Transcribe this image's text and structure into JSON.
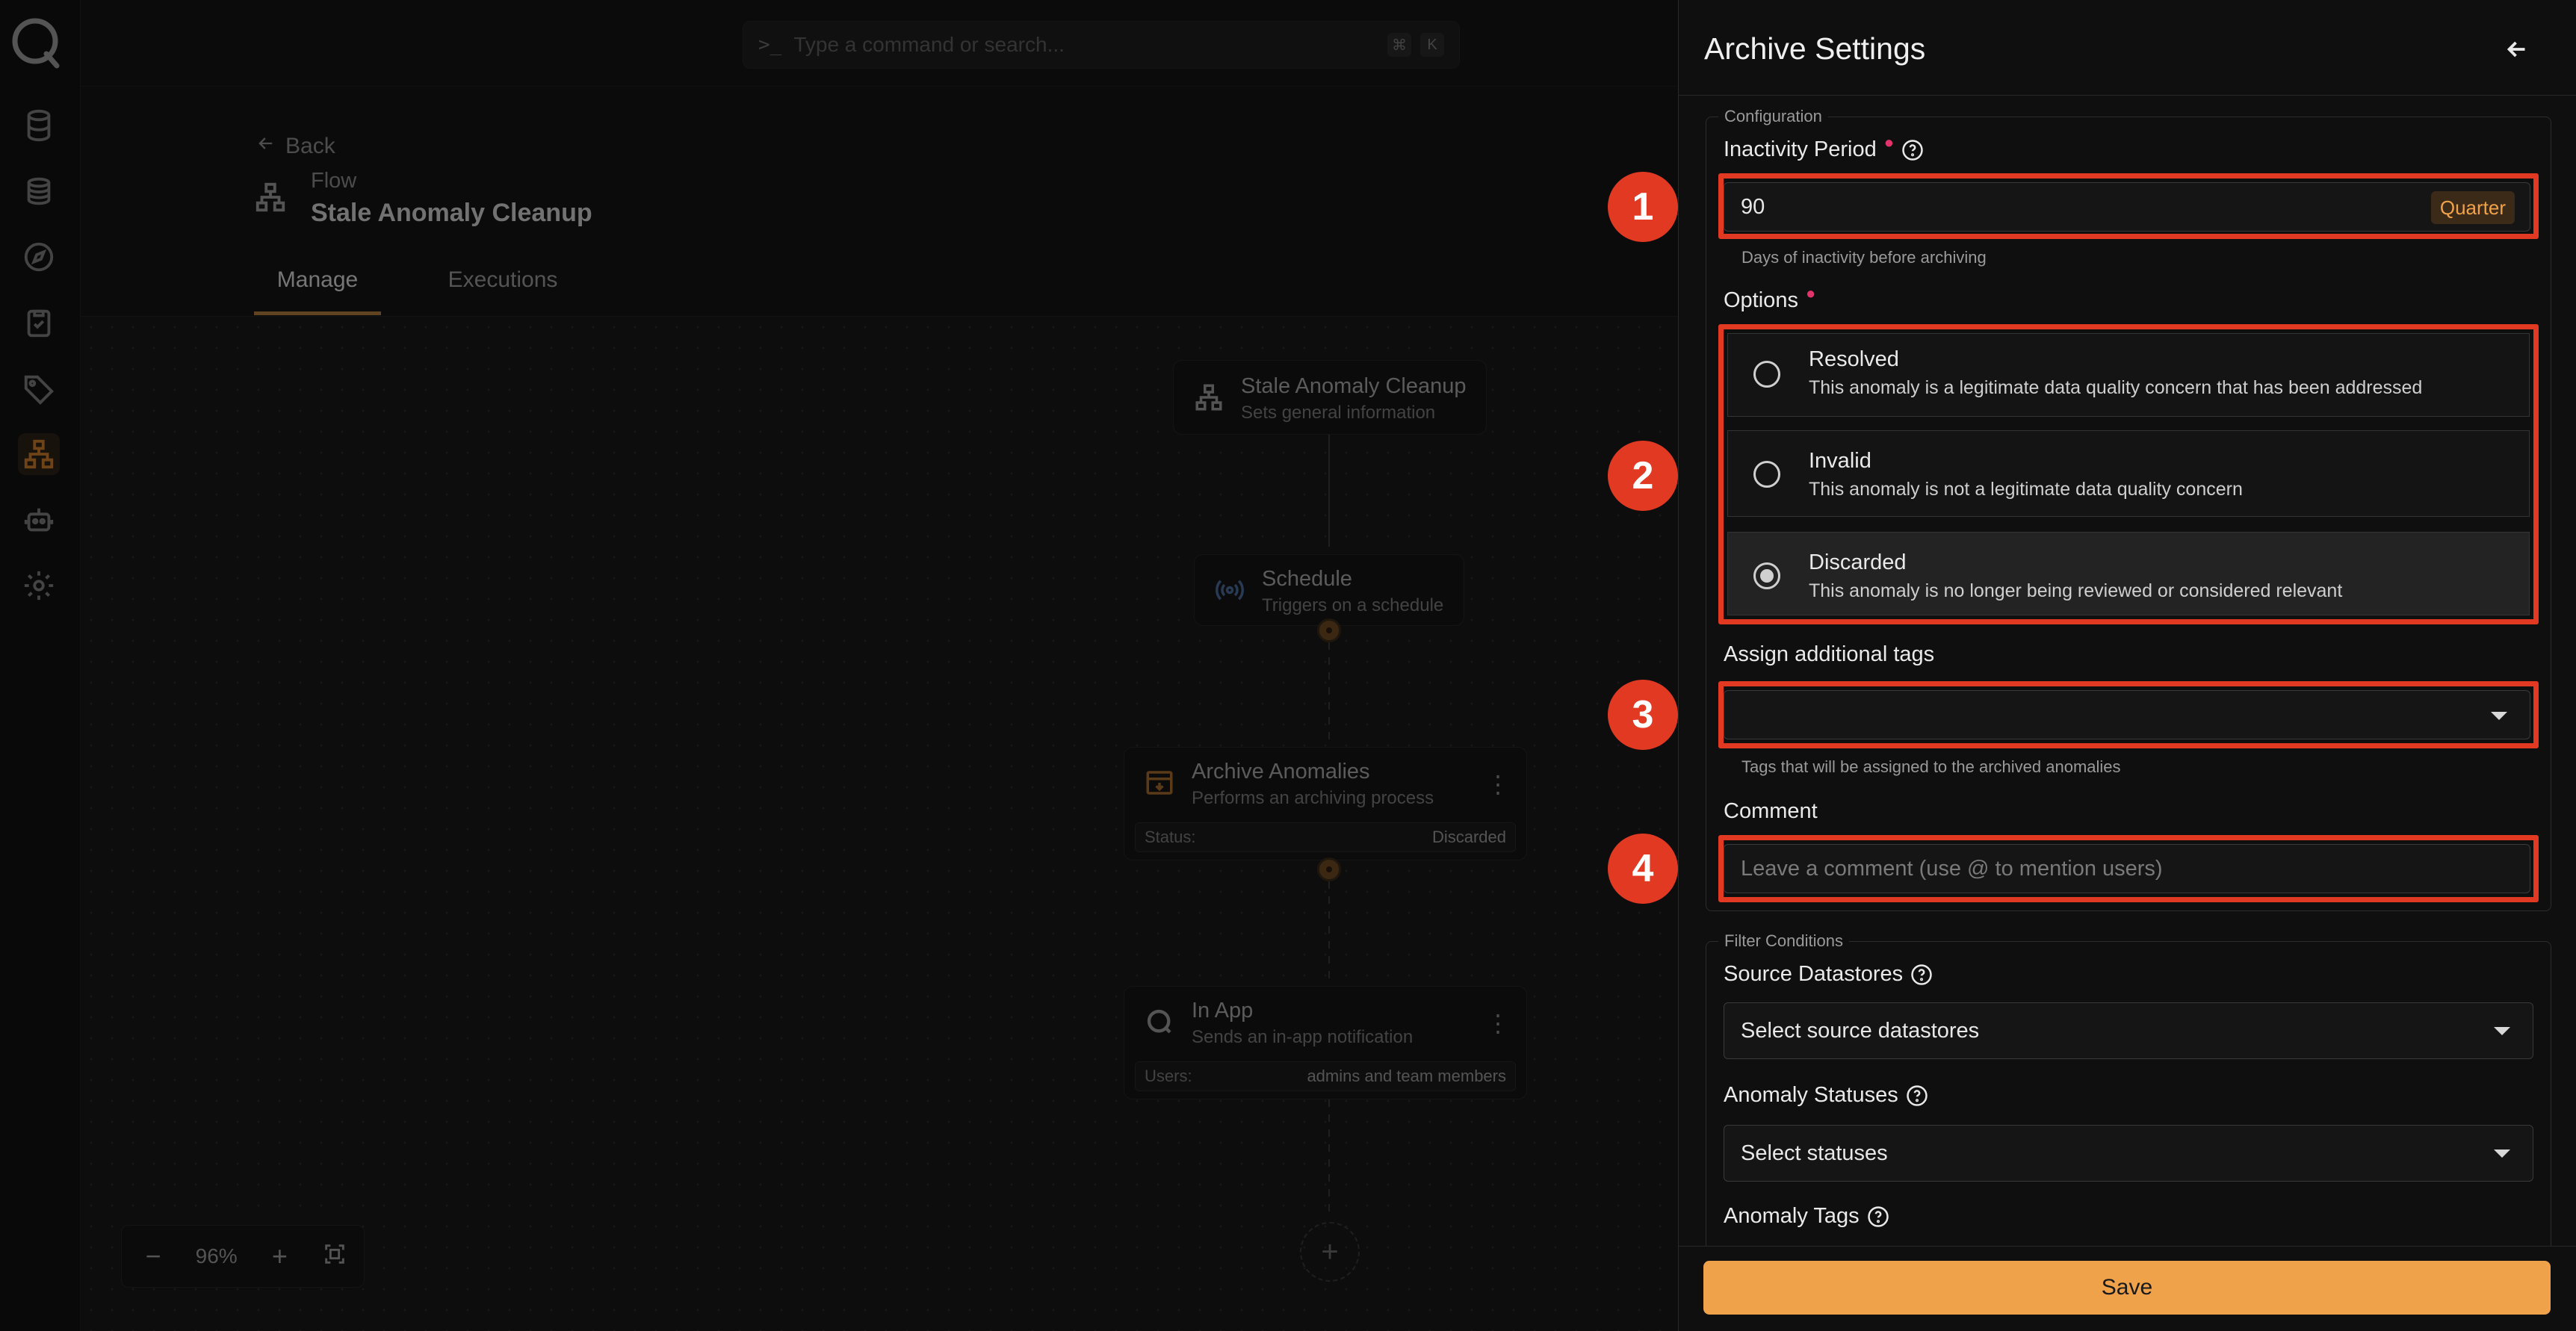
{
  "command_bar": {
    "placeholder": "Type a command or search...",
    "shortcut_1": "⌘",
    "shortcut_2": "K"
  },
  "header": {
    "back_label": "Back",
    "kicker": "Flow",
    "title": "Stale Anomaly Cleanup",
    "tabs": [
      "Manage",
      "Executions"
    ]
  },
  "flow_nodes": [
    {
      "title": "Stale Anomaly Cleanup",
      "subtitle": "Sets general information"
    },
    {
      "title": "Schedule",
      "subtitle": "Triggers on a schedule"
    },
    {
      "title": "Archive Anomalies",
      "subtitle": "Performs an archiving process",
      "info_label": "Status:",
      "info_value": "Discarded"
    },
    {
      "title": "In App",
      "subtitle": "Sends an in-app notification",
      "info_label": "Users:",
      "info_value": "admins and team members"
    }
  ],
  "zoom": {
    "minus": "−",
    "level": "96%",
    "plus": "+"
  },
  "panel": {
    "title": "Archive Settings",
    "configuration_legend": "Configuration",
    "inactivity_label": "Inactivity Period",
    "inactivity_value": "90",
    "inactivity_suffix": "Quarter",
    "inactivity_hint": "Days of inactivity before archiving",
    "options_label": "Options",
    "options": [
      {
        "title": "Resolved",
        "description": "This anomaly is a legitimate data quality concern that has been addressed",
        "selected": false
      },
      {
        "title": "Invalid",
        "description": "This anomaly is not a legitimate data quality concern",
        "selected": false
      },
      {
        "title": "Discarded",
        "description": "This anomaly is no longer being reviewed or considered relevant",
        "selected": true
      }
    ],
    "tags_label": "Assign additional tags",
    "tags_hint": "Tags that will be assigned to the archived anomalies",
    "comment_label": "Comment",
    "comment_placeholder": "Leave a comment (use @ to mention users)",
    "filter_legend": "Filter Conditions",
    "source_label": "Source Datastores",
    "source_placeholder": "Select source datastores",
    "statuses_label": "Anomaly Statuses",
    "statuses_placeholder": "Select statuses",
    "anomaly_tags_label": "Anomaly Tags",
    "save_label": "Save"
  },
  "badges": [
    "1",
    "2",
    "3",
    "4"
  ],
  "colors": {
    "accent": "#f0a24a",
    "annotation_red": "#e23a22",
    "required": "#e2336b"
  }
}
